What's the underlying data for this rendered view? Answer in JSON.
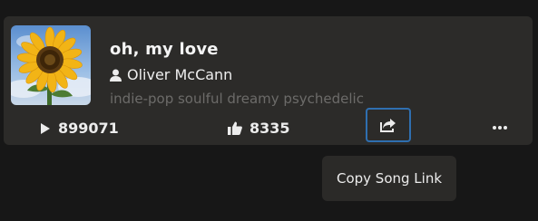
{
  "song": {
    "title": "oh, my love",
    "artist": "Oliver McCann",
    "tags": "indie-pop soulful dreamy psychedelic",
    "cover_icon": "sunflower-artwork"
  },
  "stats": {
    "plays": "899071",
    "likes": "8335",
    "play_icon": "play-icon",
    "like_icon": "thumbs-up-icon"
  },
  "actions": {
    "share_icon": "share-icon",
    "more_icon": "more-icon"
  },
  "tooltip": {
    "text": "Copy Song Link"
  },
  "colors": {
    "background": "#171717",
    "card": "#2c2b29",
    "focus_ring": "#2f6fb0",
    "tags_text": "#6c6b69"
  }
}
